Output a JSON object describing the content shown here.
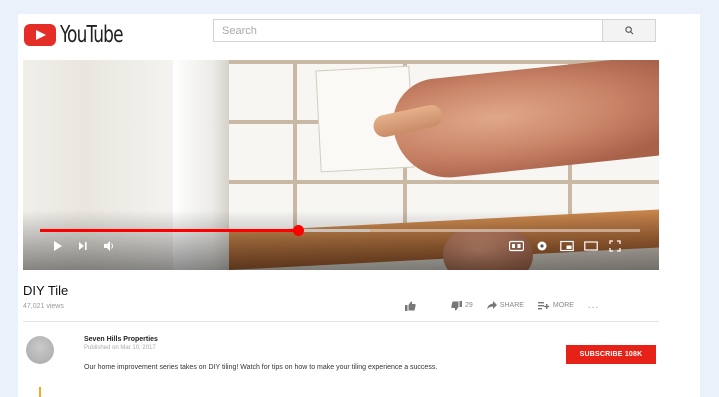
{
  "header": {
    "logo_text": "YouTube",
    "search_placeholder": "Search"
  },
  "video": {
    "progress_fraction": 0.43,
    "buffer_fraction": 0.55
  },
  "meta": {
    "title": "DIY Tile",
    "views": "47,021 views",
    "like_count": "",
    "dislike_count": "29",
    "share_label": "SHARE",
    "more_label": "MORE",
    "more_dots": "..."
  },
  "channel": {
    "name": "Seven Hills Properties",
    "published": "Published on Mar 10, 2017",
    "description": "Our home improvement series takes on DIY tiling! Watch for tips on how to make your tiling experience a success.",
    "subscribe_label": "SUBSCRIBE 108K"
  },
  "colors": {
    "brand_red": "#e62117",
    "progress_red": "#ff0000"
  },
  "icons": [
    "youtube-logo-icon",
    "search-icon",
    "play-icon",
    "next-icon",
    "volume-icon",
    "hd-icon",
    "settings-icon",
    "miniplayer-icon",
    "theater-icon",
    "fullscreen-icon",
    "like-icon",
    "dislike-icon",
    "share-icon",
    "add-to-icon"
  ]
}
